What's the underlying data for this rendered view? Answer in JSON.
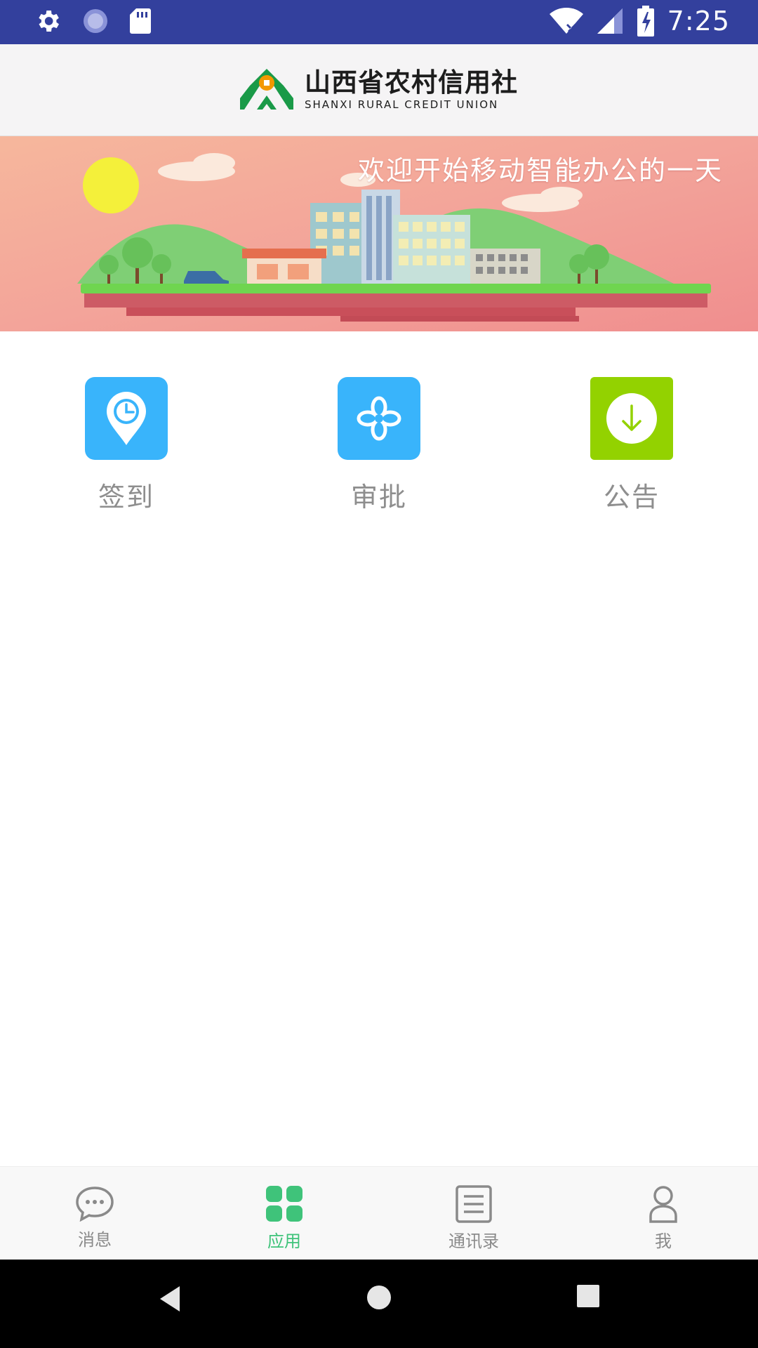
{
  "status_bar": {
    "time": "7:25"
  },
  "header": {
    "name_cn": "山西省农村信用社",
    "name_en": "SHANXI RURAL CREDIT UNION"
  },
  "banner": {
    "title": "欢迎开始移动智能办公的一天"
  },
  "apps": [
    {
      "label": "签到",
      "icon": "location-clock-icon",
      "color": "#39b4fb"
    },
    {
      "label": "审批",
      "icon": "flower-icon",
      "color": "#39b4fb"
    },
    {
      "label": "公告",
      "icon": "download-icon",
      "color": "#93d200"
    }
  ],
  "tabbar": {
    "items": [
      {
        "label": "消息",
        "icon": "chat-bubble-icon"
      },
      {
        "label": "应用",
        "icon": "grid-apps-icon",
        "active": true
      },
      {
        "label": "通讯录",
        "icon": "contacts-list-icon"
      },
      {
        "label": "我",
        "icon": "person-icon"
      }
    ]
  },
  "colors": {
    "status_bar": "#33409d",
    "accent_green": "#3fc37a",
    "app_blue": "#39b4fb",
    "app_green": "#93d200"
  }
}
